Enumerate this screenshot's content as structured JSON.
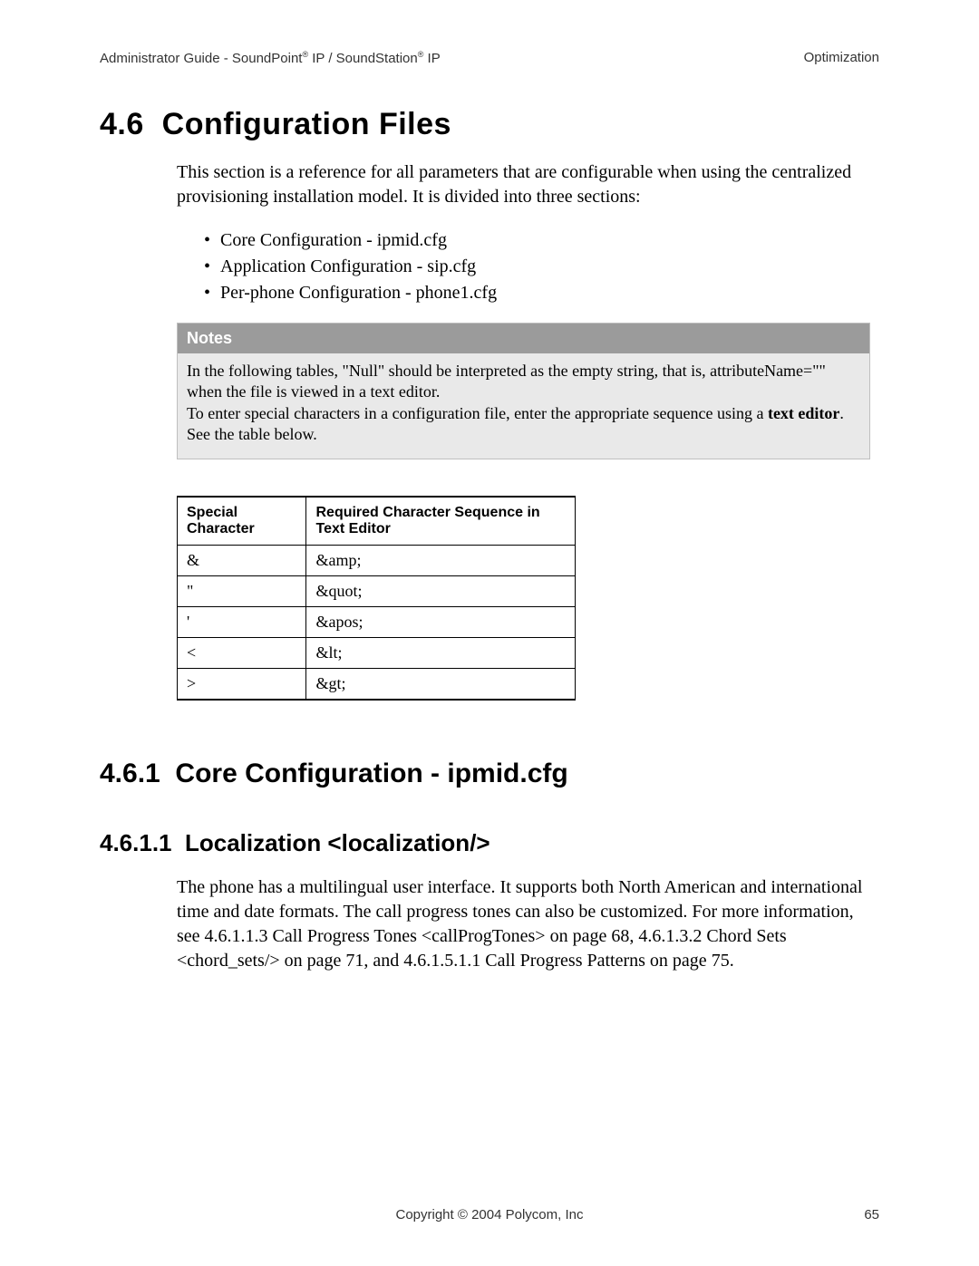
{
  "header": {
    "left_pre": "Administrator Guide - SoundPoint",
    "left_mid": " IP / SoundStation",
    "left_post": " IP",
    "reg": "®",
    "right": "Optimization"
  },
  "section": {
    "number": "4.6",
    "title": "Configuration Files",
    "intro": "This section is a reference for all parameters that are configurable when using the centralized provisioning installation model.  It is divided into three sections:",
    "bullets": [
      "Core Configuration - ipmid.cfg",
      "Application Configuration - sip.cfg",
      "Per-phone Configuration - phone1.cfg"
    ]
  },
  "notes": {
    "label": "Notes",
    "p1": "In the following tables, \"Null\" should be interpreted as the empty string, that is, attributeName=\"\" when the file is viewed in a text editor.",
    "p2a": "To enter special characters in a configuration file, enter the appropriate sequence using a ",
    "p2b_bold": "text editor",
    "p2c": ". See the table below."
  },
  "table": {
    "h1": "Special Character",
    "h2": "Required Character Sequence in Text Editor",
    "rows": [
      {
        "c1": "&",
        "c2": "&amp;"
      },
      {
        "c1": "\"",
        "c2": "&quot;"
      },
      {
        "c1": "'",
        "c2": "&apos;"
      },
      {
        "c1": "<",
        "c2": "&lt;"
      },
      {
        "c1": ">",
        "c2": "&gt;"
      }
    ]
  },
  "sub1": {
    "number": "4.6.1",
    "title": "Core Configuration - ipmid.cfg"
  },
  "sub2": {
    "number": "4.6.1.1",
    "title": "Localization <localization/>",
    "body": "The phone has a multilingual user interface.  It supports both North American and international time and date formats.  The call progress tones can also be customized. For more information, see 4.6.1.1.3 Call Progress Tones <callProgTones> on page 68, 4.6.1.3.2 Chord Sets <chord_sets/> on page 71, and 4.6.1.5.1.1 Call Progress Patterns on page 75."
  },
  "footer": {
    "center": "Copyright © 2004 Polycom, Inc",
    "page": "65"
  }
}
